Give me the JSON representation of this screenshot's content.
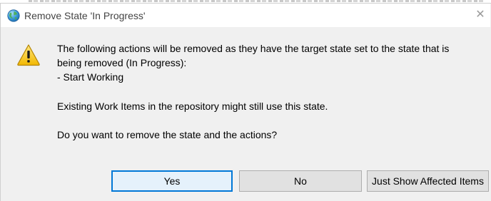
{
  "window": {
    "title": "Remove State 'In Progress'",
    "close_symbol": "✕",
    "title_icon": "globe-icon",
    "accent_color": "#0078d7"
  },
  "message": {
    "icon": "warning-icon",
    "line1": "The following actions will be removed as they have the target state set to the state that is",
    "line2": "being removed (In Progress):",
    "line3": "- Start Working",
    "line4": "Existing Work Items in the repository might still use this state.",
    "line5": "Do you want to remove the state and the actions?"
  },
  "buttons": {
    "yes": "Yes",
    "no": "No",
    "show_affected": "Just Show Affected Items"
  }
}
